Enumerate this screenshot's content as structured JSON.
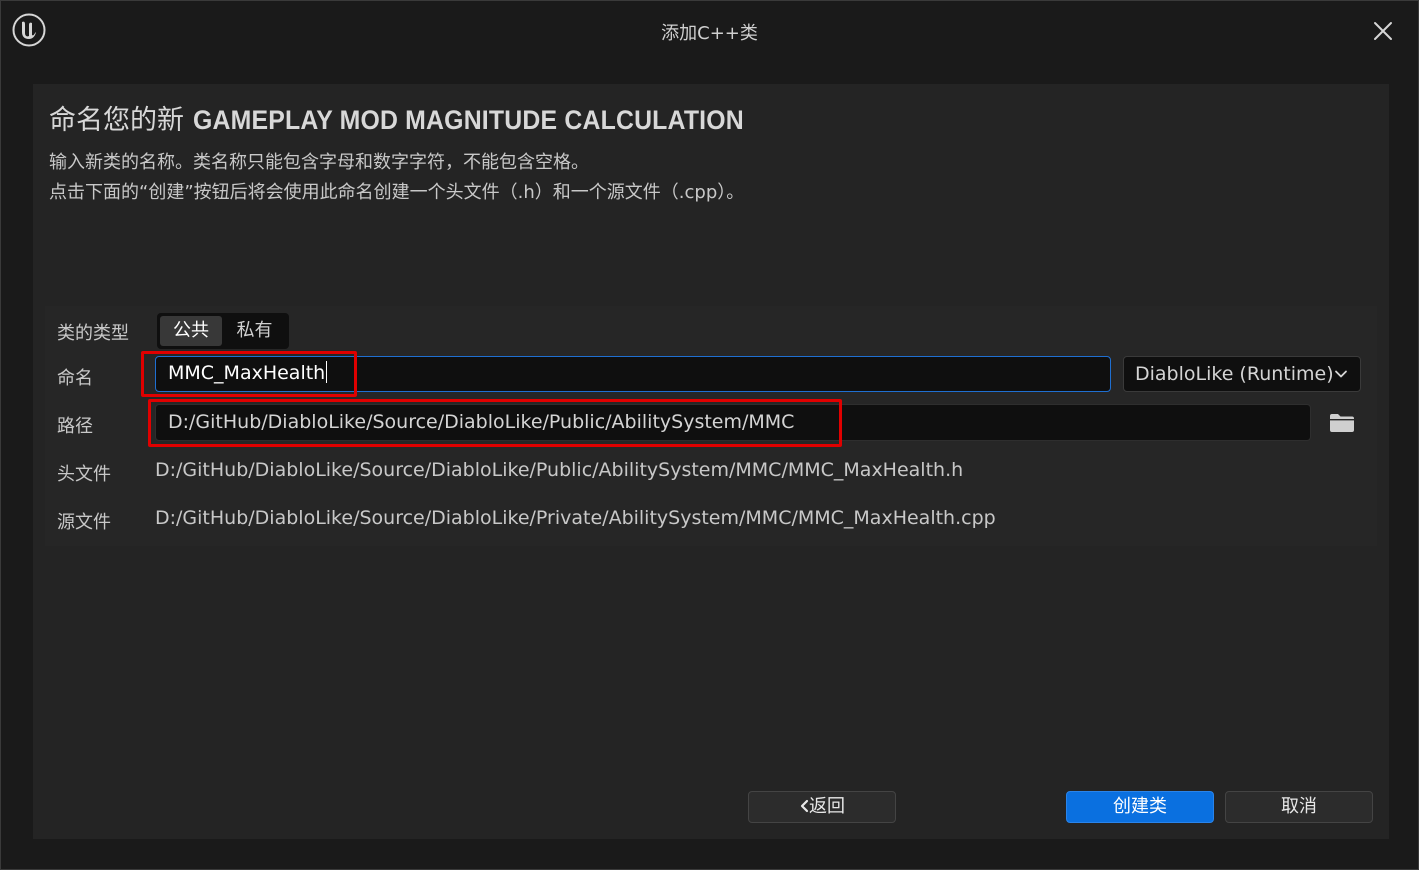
{
  "window": {
    "title": "添加C++类",
    "logo_icon": "unreal-engine-logo-icon",
    "close_icon": "close-icon"
  },
  "header": {
    "title_prefix": "命名您的新 ",
    "title_class": "GAMEPLAY MOD MAGNITUDE CALCULATION",
    "desc_line1": "输入新类的名称。类名称只能包含字母和数字字符，不能包含空格。",
    "desc_line2": "点击下面的“创建”按钮后将会使用此命名创建一个头文件（.h）和一个源文件（.cpp）。"
  },
  "form": {
    "class_type_label": "类的类型",
    "class_type_options": [
      "公共",
      "私有"
    ],
    "class_type_selected": "公共",
    "name_label": "命名",
    "name_value": "MMC_MaxHealth",
    "module_value": "DiabloLike (Runtime)",
    "path_label": "路径",
    "path_value": "D:/GitHub/DiabloLike/Source/DiabloLike/Public/AbilitySystem/MMC",
    "folder_icon": "folder-icon",
    "header_label": "头文件",
    "header_value": "D:/GitHub/DiabloLike/Source/DiabloLike/Public/AbilitySystem/MMC/MMC_MaxHealth.h",
    "source_label": "源文件",
    "source_value": "D:/GitHub/DiabloLike/Source/DiabloLike/Private/AbilitySystem/MMC/MMC_MaxHealth.cpp"
  },
  "buttons": {
    "back": "返回",
    "create": "创建类",
    "cancel": "取消"
  },
  "colors": {
    "accent": "#0a70e0",
    "highlight": "#e00000",
    "background": "#242424"
  }
}
